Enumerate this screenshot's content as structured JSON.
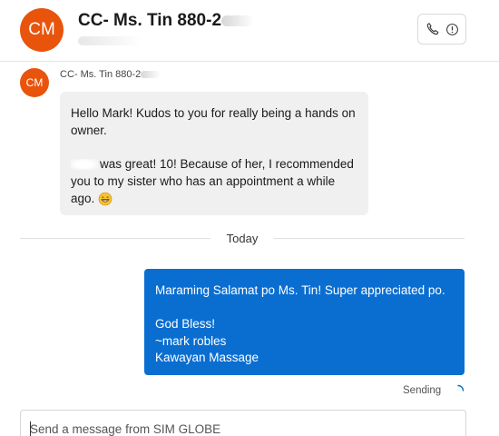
{
  "header": {
    "avatar_initials": "CM",
    "contact_name": "CC- Ms. Tin 880-2",
    "avatar_color": "#e8540c",
    "action_icons": [
      "phone-icon",
      "info-icon"
    ]
  },
  "conversation": {
    "incoming": {
      "avatar_initials": "CM",
      "sender_label": "CC- Ms. Tin 880-2",
      "line1": "Hello Mark! Kudos to you for really being a hands on owner.",
      "line2": "was great! 10! Because of her, I recommended you to my sister who has an appointment a while ago.",
      "emoji": "grinning-face-icon",
      "bubble_color": "#f0f0f0"
    },
    "divider_label": "Today",
    "outgoing": {
      "line1": "Maraming Salamat po Ms. Tin! Super appreciated po.",
      "line2": "God Bless!",
      "line3": "~mark robles",
      "line4": "Kawayan Massage",
      "bubble_color": "#0a6ed1"
    },
    "status": "Sending"
  },
  "composer": {
    "placeholder": "Send a message from SIM GLOBE",
    "value": ""
  }
}
